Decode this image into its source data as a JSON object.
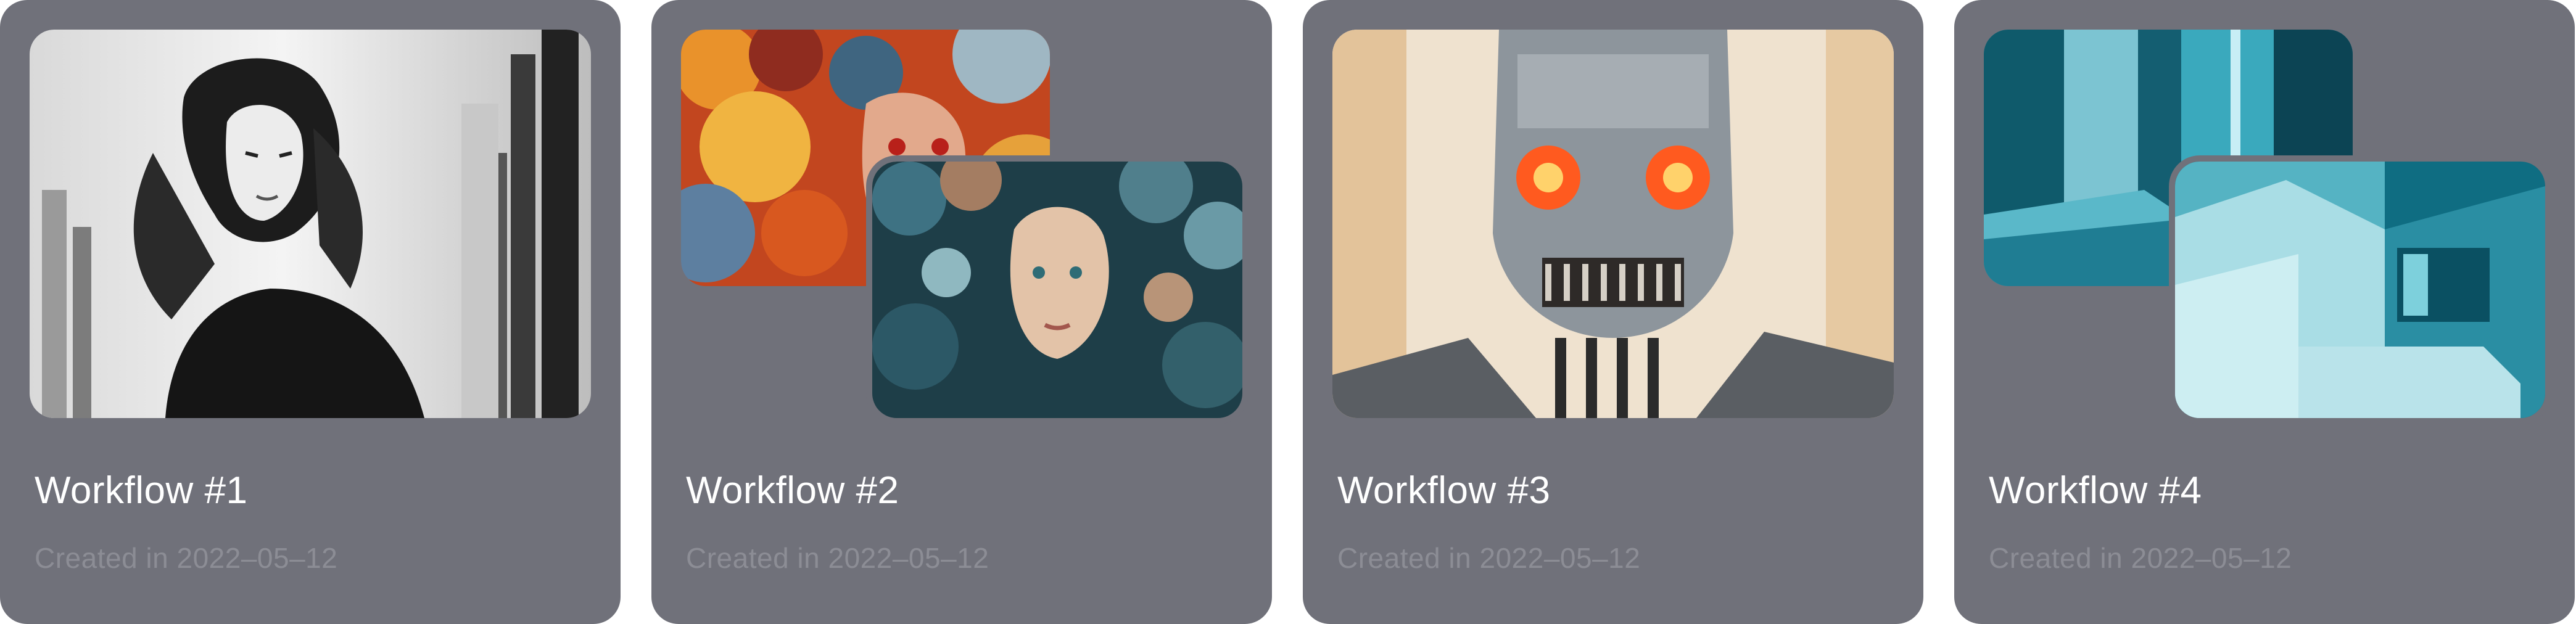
{
  "workflows": [
    {
      "title": "Workflow #1",
      "created": "Created in 2022–05–12",
      "image": "monochrome-portrait-woman-city"
    },
    {
      "title": "Workflow #2",
      "created": "Created in 2022–05–12",
      "image": "colorful-floral-portraits"
    },
    {
      "title": "Workflow #3",
      "created": "Created in 2022–05–12",
      "image": "robot-skull-orange-eyes"
    },
    {
      "title": "Workflow #4",
      "created": "Created in 2022–05–12",
      "image": "teal-architecture"
    }
  ],
  "colors": {
    "card_background": "#70717a",
    "title_text": "#ffffff",
    "date_text": "#8c8d95"
  }
}
